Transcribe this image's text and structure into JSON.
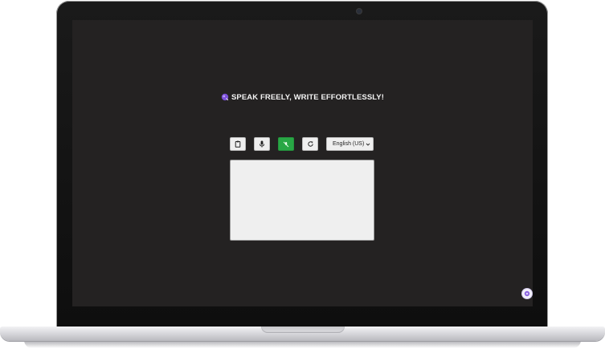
{
  "app": {
    "heading": "SPEAK FREELY, WRITE EFFORTLESSLY!",
    "heading_icon": "brand-icon",
    "accent_color": "#28a745",
    "brand_color": "#7b4fd8"
  },
  "toolbar": {
    "buttons": [
      {
        "icon": "clipboard-icon",
        "active": false
      },
      {
        "icon": "microphone-icon",
        "active": false
      },
      {
        "icon": "mic-off-icon",
        "active": true
      },
      {
        "icon": "refresh-icon",
        "active": false
      }
    ],
    "language": {
      "selected": "English (US)"
    }
  },
  "editor": {
    "value": ""
  },
  "floating_widget": {
    "icon": "assistant-icon"
  }
}
